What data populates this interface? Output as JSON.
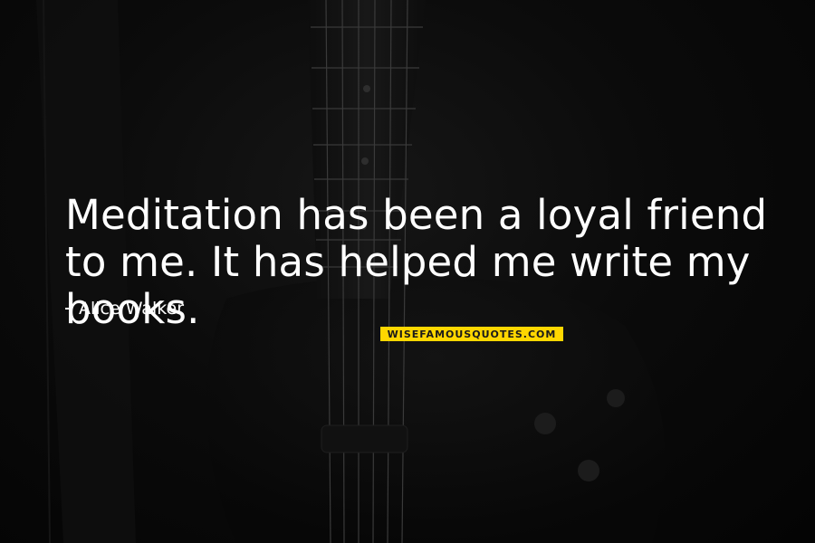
{
  "quote": {
    "text": "Meditation has been a loyal friend to me. It has helped me write my books."
  },
  "author": {
    "dash": "-",
    "name": "Alice Walker"
  },
  "watermark": {
    "text": "WISEFAMOUSQUOTES.COM",
    "color": "#ffd700"
  },
  "background": {
    "description_icon": "guitar-neck-icon",
    "tone": "#0b0b0b"
  }
}
